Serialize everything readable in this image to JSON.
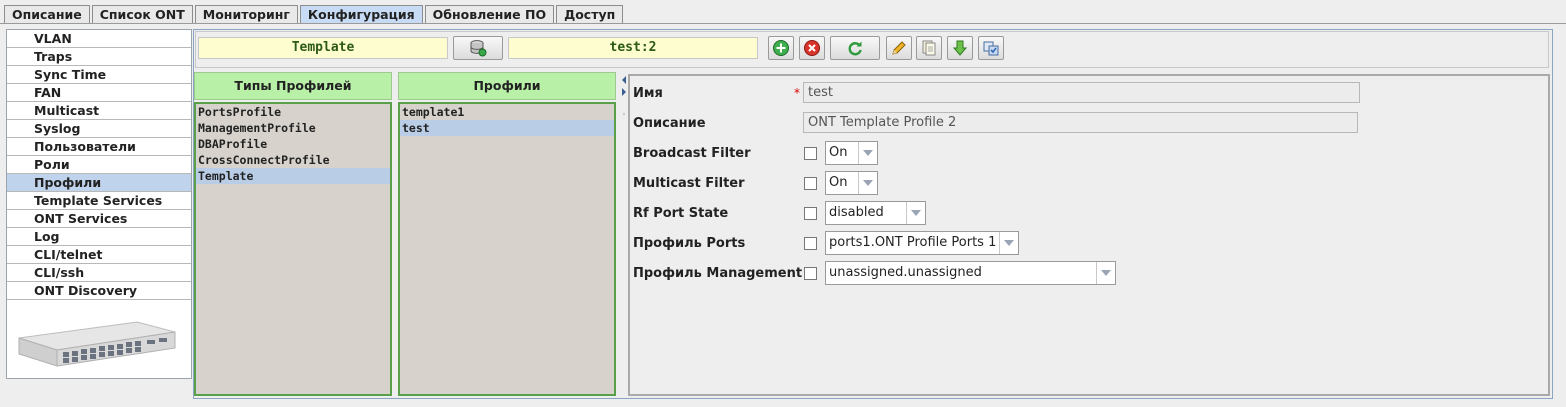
{
  "tabs": [
    {
      "label": "Описание",
      "active": false
    },
    {
      "label": "Список ONT",
      "active": false
    },
    {
      "label": "Мониторинг",
      "active": false
    },
    {
      "label": "Конфигурация",
      "active": true
    },
    {
      "label": "Обновление ПО",
      "active": false
    },
    {
      "label": "Доступ",
      "active": false
    }
  ],
  "nav": {
    "items": [
      "VLAN",
      "Traps",
      "Sync Time",
      "FAN",
      "Multicast",
      "Syslog",
      "Пользователи",
      "Роли",
      "Профили",
      "Template Services",
      "ONT Services",
      "Log",
      "CLI/telnet",
      "CLI/ssh",
      "ONT Discovery"
    ],
    "selected": "Профили"
  },
  "toolbar": {
    "profile_type": "Template",
    "profile_name": "test:2",
    "icons": [
      "database-refresh-icon",
      "add-icon",
      "delete-icon",
      "refresh-icon",
      "edit-icon",
      "copy-icon",
      "download-icon",
      "apply-icon"
    ]
  },
  "profile_types": {
    "header": "Типы Профилей",
    "items": [
      "PortsProfile",
      "ManagementProfile",
      "DBAProfile",
      "CrossConnectProfile",
      "Template"
    ],
    "selected": "Template"
  },
  "profiles": {
    "header": "Профили",
    "items": [
      "template1",
      "test"
    ],
    "selected": "test"
  },
  "form": {
    "name_label": "Имя",
    "name_value": "test",
    "name_required": "*",
    "desc_label": "Описание",
    "desc_value": "ONT Template Profile 2",
    "broadcast_label": "Broadcast Filter",
    "broadcast_value": "On",
    "multicast_label": "Multicast Filter",
    "multicast_value": "On",
    "rf_label": "Rf Port State",
    "rf_value": "disabled",
    "ports_label": "Профиль Ports",
    "ports_value": "ports1.ONT Profile Ports 1",
    "mgmt_label": "Профиль Management",
    "mgmt_value": "unassigned.unassigned"
  },
  "colors": {
    "accent": "#c0d3ec",
    "list_header": "#b8f0a8",
    "field_bg": "#fefdd0",
    "list_border": "#58a04a"
  }
}
